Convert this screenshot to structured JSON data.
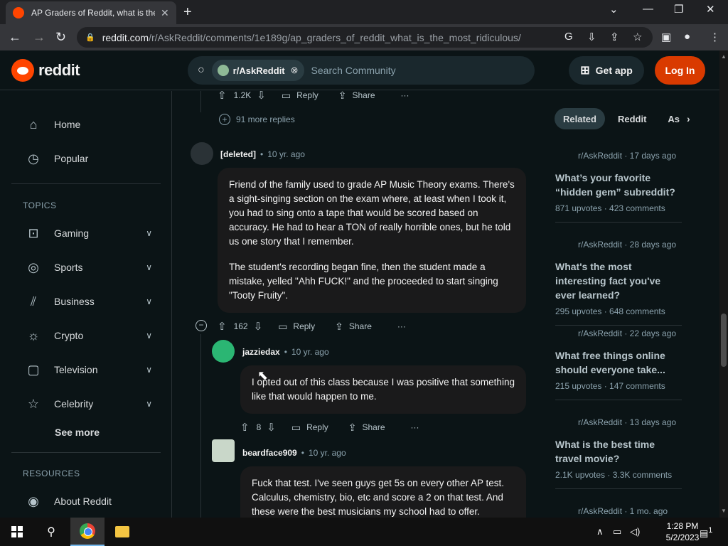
{
  "browser": {
    "tab_title": "AP Graders of Reddit, what is the",
    "url_host": "reddit.com",
    "url_path": "/r/AskReddit/comments/1e189g/ap_graders_of_reddit_what_is_the_most_ridiculous/"
  },
  "header": {
    "logo_text": "reddit",
    "community_chip": "r/AskReddit",
    "search_placeholder": "Search Community",
    "get_app": "Get app",
    "login": "Log In"
  },
  "sidebar": {
    "home": "Home",
    "popular": "Popular",
    "topics_heading": "TOPICS",
    "topics": [
      "Gaming",
      "Sports",
      "Business",
      "Crypto",
      "Television",
      "Celebrity"
    ],
    "see_more": "See more",
    "resources_heading": "RESOURCES",
    "about": "About Reddit"
  },
  "thread": {
    "top_actions": {
      "score": "1.2K",
      "reply": "Reply",
      "share": "Share",
      "more": "···"
    },
    "more_replies": "91 more replies",
    "comments": [
      {
        "author": "[deleted]",
        "time": "10 yr. ago",
        "paragraphs": [
          "Friend of the family used to grade AP Music Theory exams. There's a sight-singing section on the exam where, at least when I took it, you had to sing onto a tape that would be scored based on accuracy. He had to hear a TON of really horrible ones, but he told us one story that I remember.",
          "The student's recording began fine, then the student made a mistake, yelled \"Ahh FUCK!\" and the proceeded to start singing \"Tooty Fruity\"."
        ],
        "score": "162",
        "reply": "Reply",
        "share": "Share",
        "more": "···"
      },
      {
        "author": "jazziedax",
        "time": "10 yr. ago",
        "paragraphs": [
          "I opted out of this class because I was positive that something like that would happen to me."
        ],
        "score": "8",
        "reply": "Reply",
        "share": "Share",
        "more": "···"
      },
      {
        "author": "beardface909",
        "time": "10 yr. ago",
        "paragraphs": [
          "Fuck that test. I've seen guys get 5s on every other AP test. Calculus, chemistry, bio, etc and score a 2 on that test. And these were the best musicians my school had to offer."
        ]
      }
    ]
  },
  "related": {
    "tabs": [
      "Related",
      "Reddit",
      "As"
    ],
    "posts": [
      {
        "sub": "r/AskReddit · 17 days ago",
        "title": "What’s your favorite “hidden gem” subreddit?",
        "stats": "871 upvotes · 423 comments"
      },
      {
        "sub": "r/AskReddit · 28 days ago",
        "title": "What's the most interesting fact you've ever learned?",
        "stats": "295 upvotes · 648 comments"
      },
      {
        "sub": "r/AskReddit · 22 days ago",
        "title": "What free things online should everyone take...",
        "stats": "215 upvotes · 147 comments"
      },
      {
        "sub": "r/AskReddit · 13 days ago",
        "title": "What is the best time travel movie?",
        "stats": "2.1K upvotes · 3.3K comments"
      },
      {
        "sub": "r/AskReddit · 1 mo. ago"
      }
    ]
  },
  "taskbar": {
    "time": "1:28 PM",
    "date": "5/2/2023",
    "notif_count": "1"
  }
}
